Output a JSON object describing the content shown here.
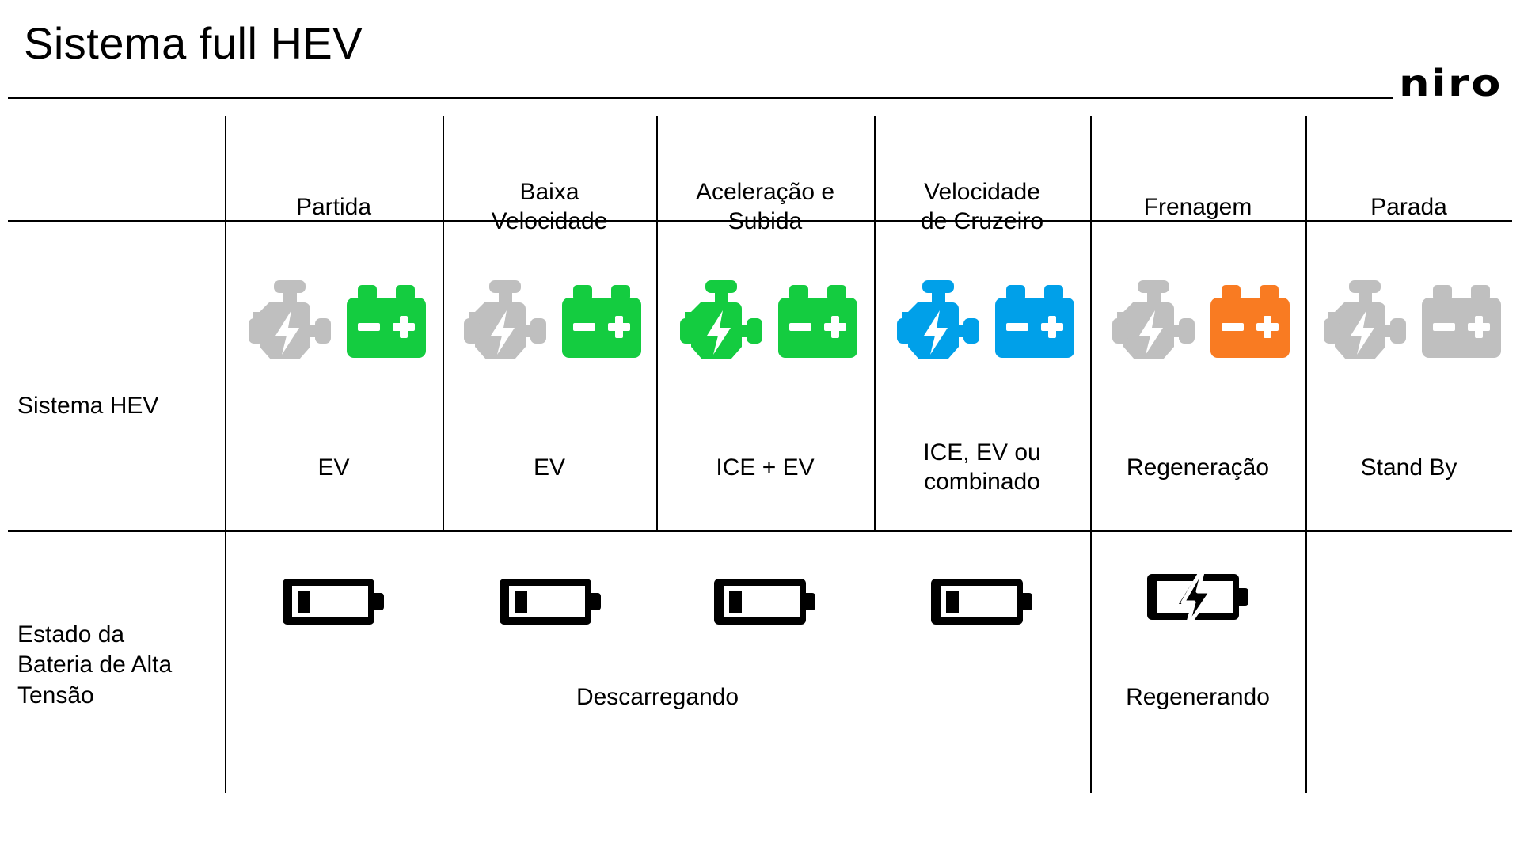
{
  "header": {
    "title": "Sistema full HEV",
    "brand": "niro"
  },
  "colors": {
    "green": "#14CC40",
    "blue": "#00A0E9",
    "orange": "#F97B22",
    "gray": "#BFBFBF",
    "black": "#000000",
    "background": "#FFFFFF"
  },
  "table": {
    "columns": [
      {
        "header": "Partida"
      },
      {
        "header": "Baixa\nVelocidade"
      },
      {
        "header": "Aceleração e\nSubida"
      },
      {
        "header": "Velocidade\nde Cruzeiro"
      },
      {
        "header": "Frenagem"
      },
      {
        "header": "Parada"
      }
    ],
    "rows": [
      {
        "label": "Sistema HEV",
        "cells": [
          {
            "engine_color": "gray",
            "battery_color": "green",
            "mode": "EV"
          },
          {
            "engine_color": "gray",
            "battery_color": "green",
            "mode": "EV"
          },
          {
            "engine_color": "green",
            "battery_color": "green",
            "mode": "ICE + EV"
          },
          {
            "engine_color": "blue",
            "battery_color": "blue",
            "mode": "ICE, EV ou\ncombinado"
          },
          {
            "engine_color": "gray",
            "battery_color": "orange",
            "mode": "Regeneração"
          },
          {
            "engine_color": "gray",
            "battery_color": "gray",
            "mode": "Stand By"
          }
        ]
      },
      {
        "label": "Estado da\nBateria de Alta\nTensão",
        "cells": [
          {
            "icon": "battery-low-icon"
          },
          {
            "icon": "battery-low-icon"
          },
          {
            "icon": "battery-low-icon"
          },
          {
            "icon": "battery-low-icon"
          },
          {
            "icon": "battery-charging-icon"
          },
          {
            "icon": ""
          }
        ],
        "status": [
          {
            "text": "Descarregando",
            "spans": "columns-1-4"
          },
          {
            "text": "Regenerando",
            "spans": "column-5"
          }
        ]
      }
    ]
  }
}
